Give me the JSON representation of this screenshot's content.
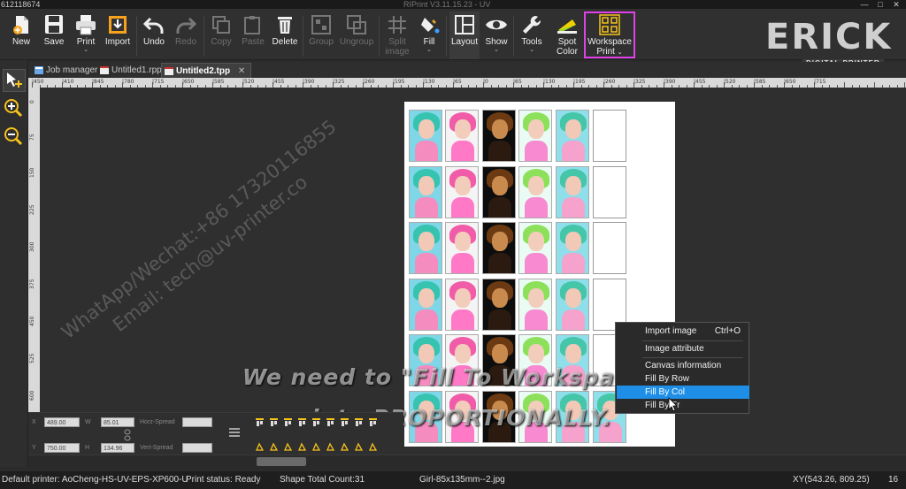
{
  "window": {
    "title_left": "612118674",
    "title_center": "RIPrint V3.11.15.23 - UV",
    "controls": [
      "—",
      "□",
      "✕"
    ]
  },
  "toolbar": {
    "buttons": [
      {
        "label": "New",
        "icon": "new-file-icon",
        "enabled": true
      },
      {
        "label": "Save",
        "icon": "save-icon",
        "enabled": true
      },
      {
        "label": "Print",
        "icon": "printer-icon",
        "enabled": true,
        "dropdown": true
      },
      {
        "label": "Import",
        "icon": "import-icon",
        "enabled": true
      },
      {
        "label": "Undo",
        "icon": "undo-icon",
        "enabled": true
      },
      {
        "label": "Redo",
        "icon": "redo-icon",
        "enabled": false
      },
      {
        "label": "Copy",
        "icon": "copy-icon",
        "enabled": false
      },
      {
        "label": "Paste",
        "icon": "paste-icon",
        "enabled": false
      },
      {
        "label": "Delete",
        "icon": "trash-icon",
        "enabled": true
      },
      {
        "label": "Group",
        "icon": "group-icon",
        "enabled": false
      },
      {
        "label": "Ungroup",
        "icon": "ungroup-icon",
        "enabled": false
      },
      {
        "label": "Split",
        "label2": "image",
        "icon": "split-icon",
        "enabled": false
      },
      {
        "label": "Fill",
        "icon": "fill-bucket-icon",
        "enabled": true,
        "dropdown": true
      },
      {
        "label": "Layout",
        "icon": "layout-icon",
        "enabled": true
      },
      {
        "label": "Show",
        "icon": "eye-icon",
        "enabled": true,
        "dropdown": true
      },
      {
        "label": "Tools",
        "icon": "wrench-icon",
        "enabled": true,
        "dropdown": true
      },
      {
        "label": "Spot",
        "label2": "Color",
        "icon": "spot-color-icon",
        "enabled": true
      },
      {
        "label": "Workspace",
        "label2": "Print",
        "icon": "workspace-grid-icon",
        "enabled": true,
        "dropdown": true
      }
    ],
    "highlight_color": "#e040e8"
  },
  "logo": {
    "word": "ERICK",
    "sub": "DIGITAL PRINTER"
  },
  "left_tools": [
    {
      "icon": "select-arrow-icon",
      "active": true
    },
    {
      "icon": "zoom-in-icon",
      "active": false
    },
    {
      "icon": "zoom-out-icon",
      "active": false
    }
  ],
  "tabs": [
    {
      "label": "Job manager",
      "icon": "job-manager-icon",
      "active": false
    },
    {
      "label": "Untitled1.rpp",
      "icon": "document-icon",
      "active": false
    },
    {
      "label": "Untitled2.tpp",
      "icon": "document-icon",
      "active": true,
      "close": "✕"
    }
  ],
  "ruler_h": [
    "|450",
    "|410",
    "|845",
    "|780",
    "|715",
    "|650",
    "|585",
    "|520",
    "|455",
    "|390",
    "|325",
    "|260",
    "|195",
    "|130",
    "|65",
    "|0",
    "|65",
    "|130",
    "|195",
    "|260",
    "|325",
    "|390",
    "|455",
    "|520",
    "|585",
    "|650",
    "|715"
  ],
  "ruler_v": [
    "0",
    "75",
    "150",
    "225",
    "300",
    "375",
    "450",
    "525",
    "600",
    "675"
  ],
  "watermark": {
    "line1": "WhatApp/Wechat:+86 17320116855",
    "line2": "Email: tech@uv-printer.co"
  },
  "subtitles": {
    "line1": "We need to \"Fill To Workspace Frame\"",
    "line2": "into PROPORTIONALLY."
  },
  "context_menu": {
    "items": [
      {
        "label": "Import image",
        "shortcut": "Ctrl+O",
        "highlighted": false
      },
      {
        "label": "Image attribute",
        "shortcut": "",
        "highlighted": false
      },
      {
        "label": "Canvas information",
        "shortcut": "",
        "highlighted": false
      },
      {
        "label": "Fill By Row",
        "shortcut": "",
        "highlighted": false
      },
      {
        "label": "Fill By Col",
        "shortcut": "",
        "highlighted": true
      },
      {
        "label": "Fill By Fr",
        "shortcut": "",
        "highlighted": false
      }
    ],
    "highlight_color": "#1e8ee6"
  },
  "props": {
    "x_label": "X",
    "x_value": "489.00",
    "w_label": "W",
    "w_value": "85.01",
    "y_label": "Y",
    "y_value": "750.00",
    "h_label": "H",
    "h_value": "134.96",
    "hspread_label": "Horz-Spread",
    "vspread_label": "Vert-Spread"
  },
  "status": {
    "printer": "Default printer: AoCheng-HS-UV-EPS-XP600-U",
    "print_status": "Print status: Ready",
    "shape_count": "Shape Total Count:31",
    "filename": "Girl-85x135mm--2.jpg",
    "coords": "XY(543.26, 809.25)",
    "zoom": "16"
  }
}
